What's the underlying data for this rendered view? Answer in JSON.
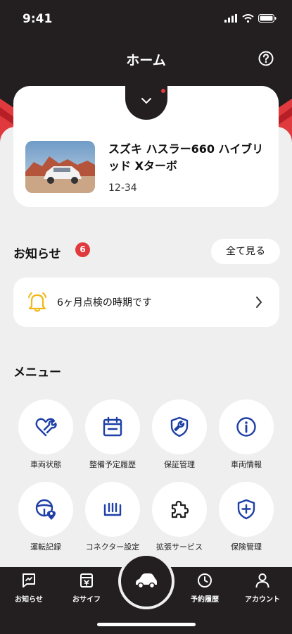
{
  "status_bar": {
    "time": "9:41"
  },
  "header": {
    "title": "ホーム"
  },
  "vehicle": {
    "name": "スズキ ハスラー660 ハイブリッド Xターボ",
    "plate": "12-34"
  },
  "notices": {
    "title": "お知らせ",
    "count": "6",
    "see_all": "全て見る",
    "items": [
      {
        "text": "6ヶ月点検の時期です"
      }
    ]
  },
  "menu": {
    "title": "メニュー",
    "items": [
      {
        "label": "車両状態",
        "icon": "heart-wrench-icon"
      },
      {
        "label": "整備予定履歴",
        "icon": "calendar-icon"
      },
      {
        "label": "保証管理",
        "icon": "shield-wrench-icon"
      },
      {
        "label": "車両情報",
        "icon": "info-icon"
      },
      {
        "label": "運転記録",
        "icon": "steering-wheel-pin-icon"
      },
      {
        "label": "コネクター設定",
        "icon": "connector-icon"
      },
      {
        "label": "拡張サービス",
        "icon": "puzzle-icon"
      },
      {
        "label": "保険管理",
        "icon": "shield-plus-icon"
      }
    ]
  },
  "bottom_nav": {
    "items": [
      {
        "label": "お知らせ",
        "icon": "notice-icon"
      },
      {
        "label": "おサイフ",
        "icon": "wallet-icon"
      },
      {
        "label": "",
        "icon": "car-icon"
      },
      {
        "label": "予約履歴",
        "icon": "clock-icon"
      },
      {
        "label": "アカウント",
        "icon": "person-icon"
      }
    ]
  },
  "colors": {
    "accent_red": "#e03a3e",
    "dark": "#231f20",
    "icon_blue": "#1d3fa6",
    "bg_light": "#efefef"
  }
}
